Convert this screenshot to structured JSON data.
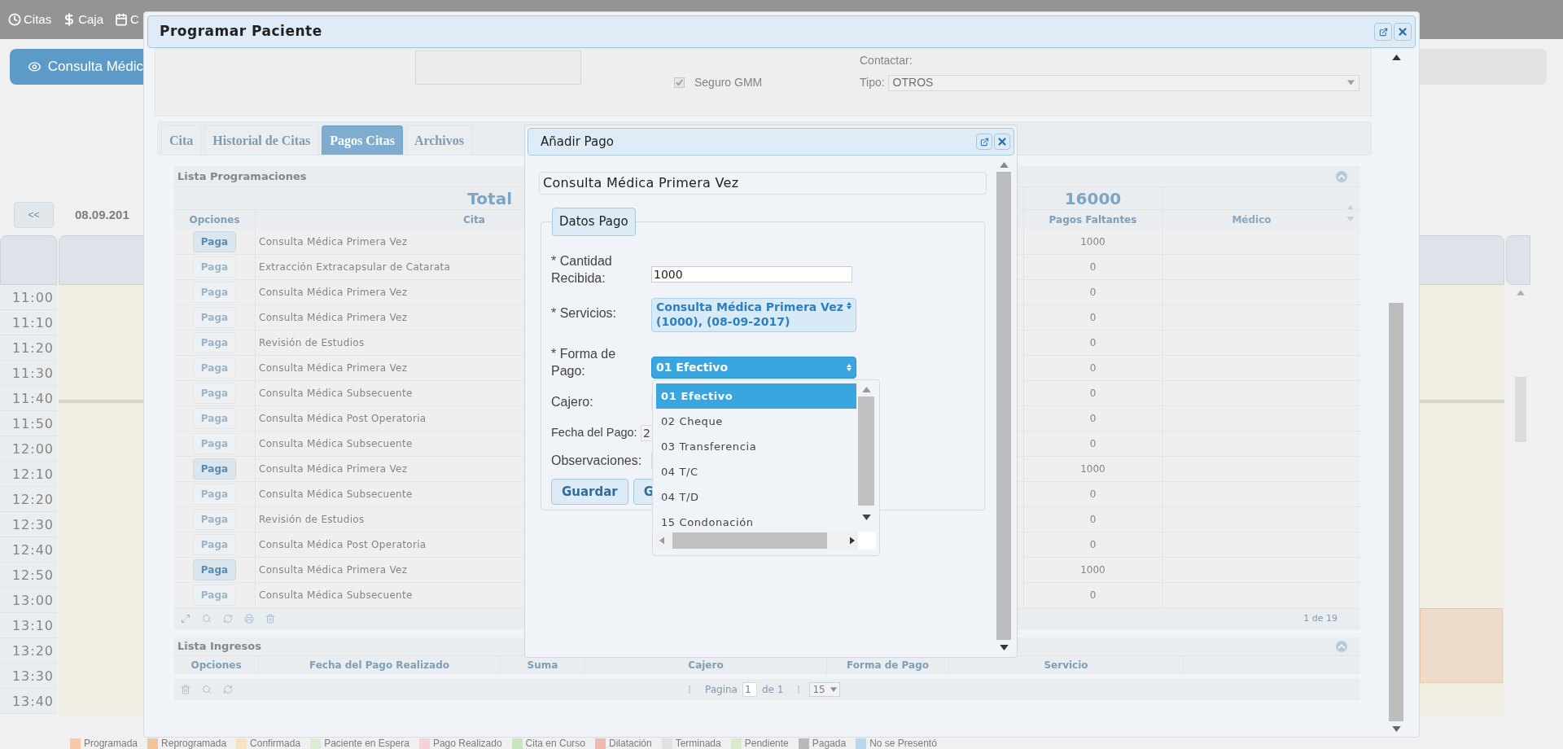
{
  "nav": [
    {
      "kind": "clock",
      "label": "Citas"
    },
    {
      "kind": "dollar",
      "label": "Caja"
    },
    {
      "kind": "calendar",
      "label": "C"
    }
  ],
  "background": {
    "action_button": "Consulta Médic",
    "prev_button": "<<",
    "date": "08.09.201",
    "times": [
      "11:00",
      "11:10",
      "11:20",
      "11:30",
      "11:40",
      "11:50",
      "12:00",
      "12:10",
      "12:20",
      "12:30",
      "12:40",
      "12:50",
      "13:00",
      "13:10",
      "13:20",
      "13:30",
      "13:40"
    ]
  },
  "legend": [
    {
      "label": "Programada",
      "color": "#f6c9a8"
    },
    {
      "label": "Reprogramada",
      "color": "#f3c299"
    },
    {
      "label": "Confirmada",
      "color": "#f5e3c3"
    },
    {
      "label": "Paciente en Espera",
      "color": "#d9edd4"
    },
    {
      "label": "Pago Realizado",
      "color": "#f6d1d8"
    },
    {
      "label": "Cita en Curso",
      "color": "#c6e6bf"
    },
    {
      "label": "Dilatación",
      "color": "#f0b8ae"
    },
    {
      "label": "Terminada",
      "color": "#e1e1e1"
    },
    {
      "label": "Pendiente",
      "color": "#d8ebcf"
    },
    {
      "label": "Pagada",
      "color": "#b9b9b9"
    },
    {
      "label": "No se Presentó",
      "color": "#b6d7ec"
    }
  ],
  "dialog": {
    "title": "Programar Paciente",
    "seguro": {
      "label": "Seguro GMM",
      "checked": true
    },
    "contact_label": "Contactar:",
    "tipo": {
      "label": "Tipo:",
      "value": "OTROS"
    },
    "tabs": [
      {
        "label": "Cita",
        "selected": false
      },
      {
        "label": "Historial de Citas",
        "selected": false
      },
      {
        "label": "Pagos Citas",
        "selected": true
      },
      {
        "label": "Archivos",
        "selected": false
      }
    ],
    "programaciones": {
      "title": "Lista Programaciones",
      "total_label": "Total",
      "total": "16000",
      "columns": [
        "Opciones",
        "Cita",
        "Pagos Faltantes",
        "Médico"
      ],
      "pager": "1 de 19",
      "rows": [
        {
          "action": "Paga",
          "disabled": false,
          "cita": "Consulta Médica Primera Vez",
          "pending": "1000"
        },
        {
          "action": "Paga",
          "disabled": true,
          "cita": "Extracción Extracapsular de Catarata",
          "pending": "0"
        },
        {
          "action": "Paga",
          "disabled": true,
          "cita": "Consulta Médica Primera Vez",
          "pending": "0"
        },
        {
          "action": "Paga",
          "disabled": true,
          "cita": "Consulta Médica Primera Vez",
          "pending": "0"
        },
        {
          "action": "Paga",
          "disabled": true,
          "cita": "Revisión de Estudios",
          "pending": "0"
        },
        {
          "action": "Paga",
          "disabled": true,
          "cita": "Consulta Médica Primera Vez",
          "pending": "0"
        },
        {
          "action": "Paga",
          "disabled": true,
          "cita": "Consulta Médica Subsecuente",
          "pending": "0"
        },
        {
          "action": "Paga",
          "disabled": true,
          "cita": "Consulta Médica Post Operatoria",
          "pending": "0"
        },
        {
          "action": "Paga",
          "disabled": true,
          "cita": "Consulta Médica Subsecuente",
          "pending": "0"
        },
        {
          "action": "Paga",
          "disabled": false,
          "cita": "Consulta Médica Primera Vez",
          "pending": "1000"
        },
        {
          "action": "Paga",
          "disabled": true,
          "cita": "Consulta Médica Subsecuente",
          "pending": "0"
        },
        {
          "action": "Paga",
          "disabled": true,
          "cita": "Revisión de Estudios",
          "pending": "0"
        },
        {
          "action": "Paga",
          "disabled": true,
          "cita": "Consulta Médica Post Operatoria",
          "pending": "0"
        },
        {
          "action": "Paga",
          "disabled": false,
          "cita": "Consulta Médica Primera Vez",
          "pending": "1000"
        },
        {
          "action": "Paga",
          "disabled": true,
          "cita": "Consulta Médica Subsecuente",
          "pending": "0"
        }
      ]
    },
    "ingresos": {
      "title": "Lista Ingresos",
      "columns": [
        "Opciones",
        "Fecha del Pago Realizado",
        "Suma",
        "Cajero",
        "Forma de Pago",
        "Servicio"
      ],
      "page_label": "Pagina",
      "page": "1",
      "page_total": "de 1",
      "page_size": "15"
    }
  },
  "payment_dialog": {
    "title": "Añadir Pago",
    "service": "Consulta Médica Primera Vez",
    "legend": "Datos Pago",
    "amount": {
      "label": "* Cantidad Recibida:",
      "value": "1000"
    },
    "services": {
      "label": "* Servicios:",
      "value": "Consulta Médica Primera Vez (1000), (08-09-2017)"
    },
    "method": {
      "label": "* Forma de Pago:",
      "value": "01 Efectivo"
    },
    "cashier": {
      "label": "Cajero:"
    },
    "date": {
      "label": "Fecha del Pago:",
      "value": "2"
    },
    "notes": {
      "label": "Observaciones:"
    },
    "buttons": [
      "Guardar",
      "G"
    ]
  },
  "dropdown": {
    "options": [
      {
        "label": "01 Efectivo",
        "selected": true
      },
      {
        "label": "02 Cheque",
        "selected": false
      },
      {
        "label": "03 Transferencia",
        "selected": false
      },
      {
        "label": "04 T/C",
        "selected": false
      },
      {
        "label": "04 T/D",
        "selected": false
      },
      {
        "label": "15 Condonación",
        "selected": false
      }
    ]
  }
}
